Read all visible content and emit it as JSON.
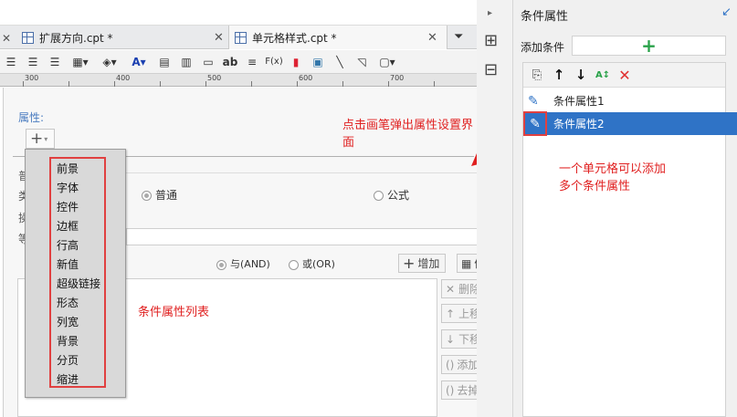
{
  "tabs": [
    {
      "label": "扩展方向.cpt *"
    },
    {
      "label": "单元格样式.cpt *"
    }
  ],
  "ruler": {
    "ticks": [
      "300",
      "400",
      "500",
      "600",
      "700"
    ]
  },
  "dialog": {
    "attr_label": "属性:",
    "add_symbol": "+",
    "radio_normal": "普通",
    "radio_formula": "公式",
    "radio_and": "与(AND)",
    "radio_or": "或(OR)",
    "btn_add": "增加",
    "btn_edit": "修改",
    "btn_delete": "删除",
    "btn_up": "上移",
    "btn_down": "下移",
    "btn_add_bracket": "添加括号",
    "btn_remove_bracket": "去掉括号",
    "partial_labels": [
      "普",
      "类",
      "操",
      "等"
    ]
  },
  "menu": {
    "items": [
      "前景",
      "字体",
      "控件",
      "边框",
      "行高",
      "新值",
      "超级链接",
      "形态",
      "列宽",
      "背景",
      "分页",
      "缩进"
    ]
  },
  "annotations": {
    "click_pen": "点击画笔弹出属性设置界面",
    "list_label": "条件属性列表",
    "multi_line1": "一个单元格可以添加",
    "multi_line2": "多个条件属性"
  },
  "panel": {
    "title": "条件属性",
    "add_label": "添加条件",
    "items": [
      {
        "label": "条件属性1",
        "selected": false
      },
      {
        "label": "条件属性2",
        "selected": true
      }
    ]
  },
  "colors": {
    "accent_blue": "#2f73c6",
    "annotation_red": "#e02020",
    "add_green": "#2aa24a",
    "delete_red": "#e03030"
  },
  "icons": [
    "new-file-icon",
    "arrow-up-icon",
    "arrow-down-icon",
    "sort-az-icon",
    "delete-x-icon",
    "pencil-icon",
    "plus-icon",
    "tab-close-icon"
  ]
}
